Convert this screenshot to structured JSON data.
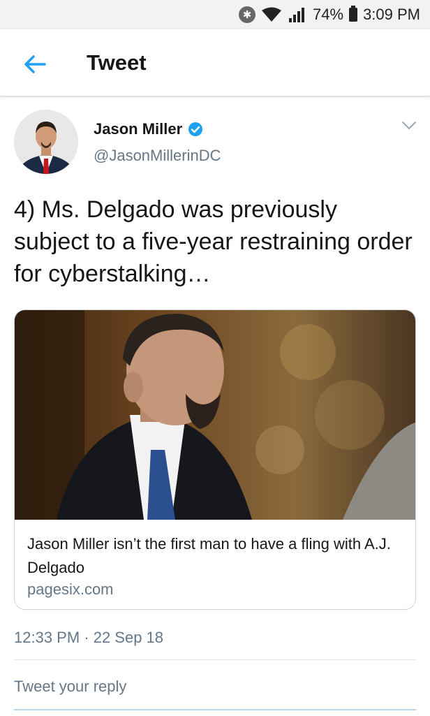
{
  "status_bar": {
    "bluetooth_icon": "bluetooth-icon",
    "wifi_icon": "wifi-icon",
    "signal_icon": "signal-icon",
    "battery": "74%",
    "battery_icon": "battery-icon",
    "time": "3:09 PM"
  },
  "header": {
    "back_icon": "arrow-left-icon",
    "title": "Tweet"
  },
  "tweet": {
    "author_name": "Jason Miller",
    "verified_icon": "verified-badge-icon",
    "handle": "@JasonMillerinDC",
    "menu_icon": "chevron-down-icon",
    "text": "4) Ms. Delgado was previously subject to a five-year restraining order for cyberstalking…",
    "card": {
      "title": "Jason Miller isn’t the first man to have a fling with A.J. Delgado",
      "domain": "pagesix.com"
    },
    "timestamp": "12:33 PM · 22 Sep 18"
  },
  "reply": {
    "placeholder": "Tweet your reply"
  },
  "colors": {
    "accent": "#1da1f2",
    "secondary_text": "#657786",
    "border": "#ccd6dd"
  }
}
